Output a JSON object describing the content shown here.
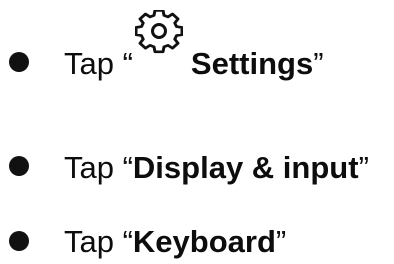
{
  "steps": [
    {
      "prefix": "Tap “",
      "icon": "settings-gear-icon",
      "emphasis": "Settings",
      "suffix": "”"
    },
    {
      "prefix": "Tap “",
      "emphasis": "Display & input",
      "suffix": "”"
    },
    {
      "prefix": "Tap “",
      "emphasis": "Keyboard",
      "suffix": "”"
    }
  ]
}
